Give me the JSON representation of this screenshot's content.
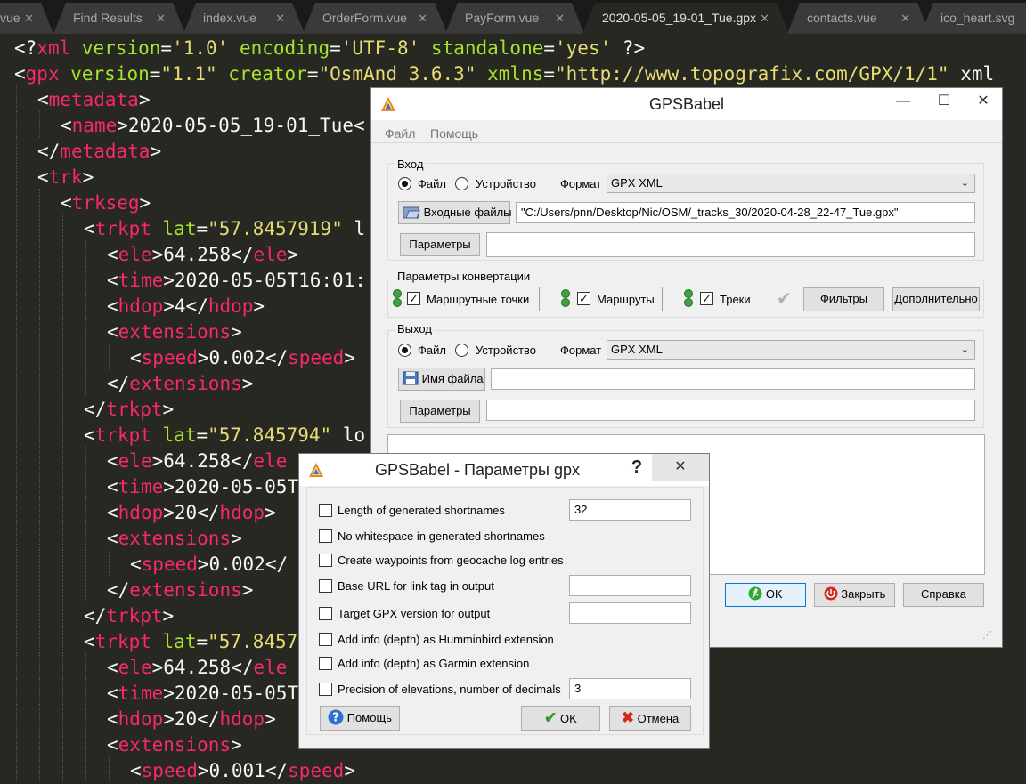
{
  "tabs": [
    {
      "label": "vue"
    },
    {
      "label": "Find Results"
    },
    {
      "label": "index.vue"
    },
    {
      "label": "OrderForm.vue"
    },
    {
      "label": "PayForm.vue"
    },
    {
      "label": "2020-05-05_19-01_Tue.gpx",
      "active": true
    },
    {
      "label": "contacts.vue"
    },
    {
      "label": "ico_heart.svg"
    }
  ],
  "code_lines": [
    "<?xml version='1.0' encoding='UTF-8' standalone='yes' ?>",
    "<gpx version=\"1.1\" creator=\"OsmAnd 3.6.3\" xmlns=\"http://www.topografix.com/GPX/1/1\" xml",
    "<metadata>",
    "<name>2020-05-05_19-01_Tue<",
    "</metadata>",
    "<trk>",
    "<trkseg>",
    "<trkpt lat=\"57.8457919\" l",
    "<ele>64.258</ele>",
    "<time>2020-05-05T16:01:",
    "<hdop>4</hdop>",
    "<extensions>",
    "<speed>0.002</speed>",
    "</extensions>",
    "</trkpt>",
    "<trkpt lat=\"57.845794\" lo",
    "<ele>64.258</ele",
    "<time>2020-05-05T",
    "<hdop>20</hdop>",
    "<extensions>",
    "<speed>0.002</",
    "</extensions>",
    "</trkpt>",
    "<trkpt lat=\"57.8457",
    "<ele>64.258</ele",
    "<time>2020-05-05T",
    "<hdop>20</hdop>",
    "<extensions>",
    "<speed>0.001</speed>"
  ],
  "main_window": {
    "title": "GPSBabel",
    "menu": [
      "Файл",
      "Помощь"
    ],
    "input": {
      "group_label": "Вход",
      "radio_file": "Файл",
      "radio_device": "Устройство",
      "format_label": "Формат",
      "format_value": "GPX XML",
      "files_button": "Входные файлы",
      "file_path": "\"C:/Users/pnn/Desktop/Nic/OSM/_tracks_30/2020-04-28_22-47_Tue.gpx\"",
      "params_button": "Параметры",
      "params_value": ""
    },
    "conversion": {
      "group_label": "Параметры конвертации",
      "waypoints": "Маршрутные точки",
      "routes": "Маршруты",
      "tracks": "Треки",
      "filters_button": "Фильтры",
      "advanced_button": "Дополнительно"
    },
    "output": {
      "group_label": "Выход",
      "radio_file": "Файл",
      "radio_device": "Устройство",
      "format_label": "Формат",
      "format_value": "GPX XML",
      "filename_button": "Имя файла",
      "filename_value": "",
      "params_button": "Параметры",
      "params_value": ""
    },
    "ok_button": "OK",
    "close_button": "Закрыть",
    "help_button": "Справка"
  },
  "dialog": {
    "title": "GPSBabel - Параметры gpx",
    "help_glyph": "?",
    "options": [
      {
        "label": "Length of generated shortnames",
        "value": "32",
        "has_field": true
      },
      {
        "label": "No whitespace in generated shortnames",
        "has_field": false
      },
      {
        "label": "Create waypoints from geocache log entries",
        "has_field": false
      },
      {
        "label": "Base URL for link tag in output",
        "value": "",
        "has_field": true
      },
      {
        "label": "Target GPX version for output",
        "value": "",
        "has_field": true
      },
      {
        "label": "Add info (depth) as Humminbird extension",
        "has_field": false
      },
      {
        "label": "Add info (depth) as Garmin extension",
        "has_field": false
      },
      {
        "label": "Precision of elevations, number of decimals",
        "value": "3",
        "has_field": true
      }
    ],
    "help_button": "Помощь",
    "ok_button": "OK",
    "cancel_button": "Отмена"
  }
}
